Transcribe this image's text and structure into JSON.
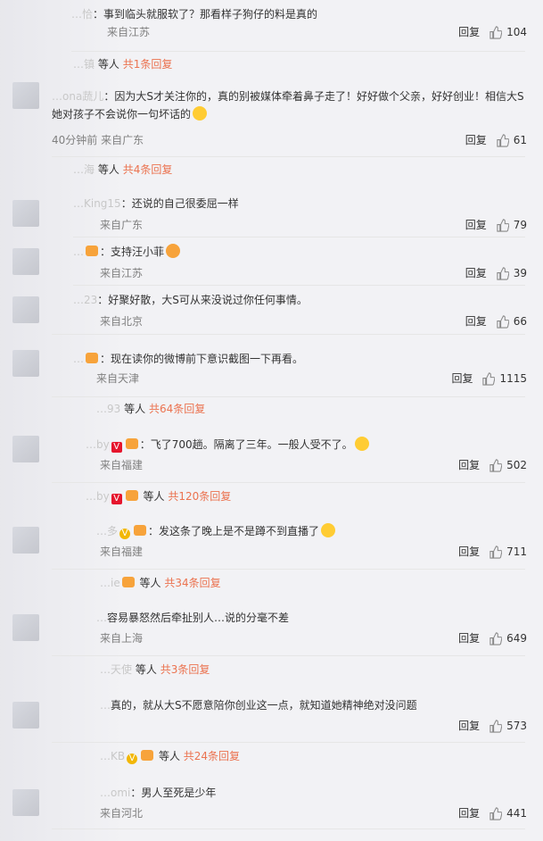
{
  "reply_label": "回复",
  "comments": [
    {
      "user": "…恰",
      "text": "事到临头就服软了？那看样子狗仔的料是真的",
      "meta": "来自江苏",
      "likes": "104",
      "summary": {
        "user": "…镇",
        "suffix": "等人",
        "count": "共1条回复"
      }
    },
    {
      "user": "…ona蔬儿",
      "text": "因为大S才关注你的，真的别被媒体牵着鼻子走了！好好做个父亲，好好创业！相信大S她对孩子不会说你一句坏话的",
      "meta": "40分钟前 来自广东",
      "likes": "61",
      "summary": {
        "user": "…海",
        "suffix": "等人",
        "count": "共4条回复"
      }
    },
    {
      "user": "…King15",
      "text": "还说的自己很委屈一样",
      "meta": "来自广东",
      "likes": "79"
    },
    {
      "user": "…",
      "text": "支持汪小菲",
      "meta": "来自江苏",
      "likes": "39"
    },
    {
      "user": "…23",
      "text": "好聚好散，大S可从来没说过你任何事情。",
      "meta": "来自北京",
      "likes": "66"
    },
    {
      "user": "…",
      "text": "现在读你的微博前下意识截图一下再看。",
      "meta": "来自天津",
      "likes": "1115",
      "summary": {
        "user": "…93",
        "suffix": "等人",
        "count": "共64条回复"
      }
    },
    {
      "user": "…by",
      "text": "飞了700趟。隔离了三年。一般人受不了。",
      "meta": "来自福建",
      "likes": "502",
      "summary": {
        "user": "…by",
        "suffix": "等人",
        "count": "共120条回复"
      }
    },
    {
      "user": "…多",
      "text": "发这条了晚上是不是蹲不到直播了",
      "meta": "来自福建",
      "likes": "711",
      "summary": {
        "user": "…ie",
        "suffix": "等人",
        "count": "共34条回复"
      }
    },
    {
      "user": "…",
      "text": "容易暴怒然后牵扯别人…说的分毫不差",
      "meta": "来自上海",
      "likes": "649",
      "summary": {
        "user": "…天使",
        "suffix": "等人",
        "count": "共3条回复"
      }
    },
    {
      "user": "…",
      "text": "真的，就从大S不愿意陪你创业这一点，就知道她精神绝对没问题",
      "meta": "",
      "likes": "573",
      "summary": {
        "user": "…KB",
        "suffix": "等人",
        "count": "共24条回复"
      }
    },
    {
      "user": "…omi",
      "text": "男人至死是少年",
      "meta": "来自河北",
      "likes": "441"
    }
  ],
  "colors": {
    "accent": "#eb7350",
    "link": "#eb7350",
    "bg": "#f2f2f5"
  }
}
